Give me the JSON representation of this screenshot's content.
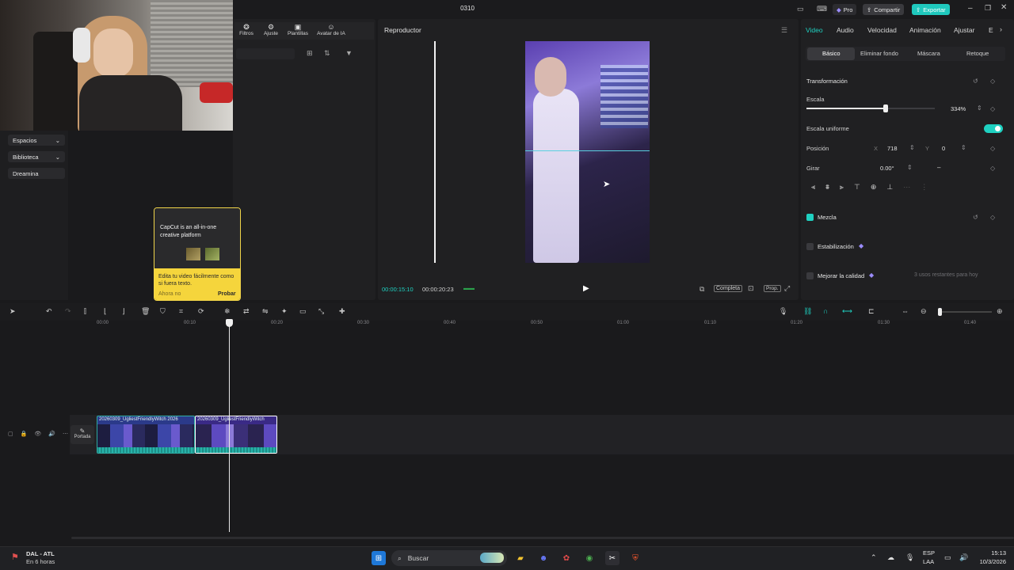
{
  "window": {
    "title": "0310",
    "pro_label": "Pro",
    "share_label": "Compartir",
    "export_label": "Exportar"
  },
  "media_tabs": [
    {
      "label": "Filtros",
      "icon": "filter-icon"
    },
    {
      "label": "Ajuste",
      "icon": "sliders-icon"
    },
    {
      "label": "Plantillas",
      "icon": "template-icon"
    },
    {
      "label": "Avatar de IA",
      "icon": "avatar-icon"
    }
  ],
  "left_nav": {
    "spaces": "Espacios",
    "library": "Biblioteca",
    "dreamina": "Dreamina"
  },
  "tooltip": {
    "headline": "CapCut is an all-in-one creative platform",
    "body": "Edita tu video fácilmente como si fuera texto.",
    "dismiss": "Ahora no",
    "try": "Probar"
  },
  "player": {
    "title": "Reproductor",
    "current_time": "00:00:15:10",
    "total_time": "00:00:20:23",
    "fit_label": "Completa",
    "ratio_label": "Prop."
  },
  "props": {
    "tabs": [
      "Video",
      "Audio",
      "Velocidad",
      "Animación",
      "Ajustar",
      "E"
    ],
    "active_tab": "Video",
    "subtabs": [
      "Básico",
      "Eliminar fondo",
      "Máscara",
      "Retoque"
    ],
    "transform_label": "Transformación",
    "scale_label": "Escala",
    "scale_value": "334%",
    "scale_level": 0.62,
    "uniform_label": "Escala uniforme",
    "position_label": "Posición",
    "pos_x_label": "X",
    "pos_x": "718",
    "pos_y_label": "Y",
    "pos_y": "0",
    "rotate_label": "Girar",
    "rotate_value": "0.00°",
    "blend_label": "Mezcla",
    "stabilize_label": "Estabilización",
    "enhance_label": "Mejorar la calidad",
    "enhance_note": "3 usos restantes para hoy",
    "accent": "#1fd1c1"
  },
  "timeline": {
    "ticks": [
      "00:00",
      "00:10",
      "00:20",
      "00:30",
      "00:40",
      "00:50",
      "01:00",
      "01:10",
      "01:20",
      "01:30",
      "01:40"
    ],
    "clip1_label": "20260309_UgliestFriendlyWitch  2026",
    "clip2_label": "20260309_UgliestFriendlyWitch",
    "cover_label": "Portada"
  },
  "taskbar": {
    "weather_line1": "DAL - ATL",
    "weather_line2": "En 6 horas",
    "search_placeholder": "Buscar",
    "lang_line1": "ESP",
    "lang_line2": "LAA",
    "time": "15:13",
    "date": "10/3/2026"
  }
}
